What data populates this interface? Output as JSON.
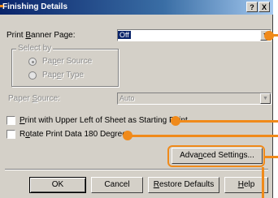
{
  "window": {
    "title": "Finishing Details",
    "help_button": "?",
    "close_button": "X"
  },
  "banner": {
    "label_pre": "Print ",
    "label_ul": "B",
    "label_post": "anner Page:",
    "value": "Off"
  },
  "select_by": {
    "title": "Select by",
    "options": [
      {
        "pre": "Pa",
        "ul": "p",
        "post": "er Source",
        "selected": true
      },
      {
        "pre": "Pap",
        "ul": "e",
        "post": "r Type",
        "selected": false
      }
    ]
  },
  "paper_source": {
    "label_pre": "Paper ",
    "label_ul": "S",
    "label_post": "ource:",
    "value": "Auto"
  },
  "checks": [
    {
      "pre": "",
      "ul": "P",
      "post": "rint with Upper Left of Sheet as Starting Point",
      "checked": false
    },
    {
      "pre": "R",
      "ul": "o",
      "post": "tate Print Data 180 Degrees",
      "checked": false
    }
  ],
  "advanced": {
    "pre": "Adva",
    "ul": "n",
    "post": "ced Settings..."
  },
  "buttons": {
    "ok": "OK",
    "cancel": "Cancel",
    "restore": {
      "pre": "",
      "ul": "R",
      "post": "estore Defaults"
    },
    "help": {
      "pre": "",
      "ul": "H",
      "post": "elp"
    }
  },
  "colors": {
    "callout": "#f08a1a",
    "titlebar": "#0a246a"
  }
}
